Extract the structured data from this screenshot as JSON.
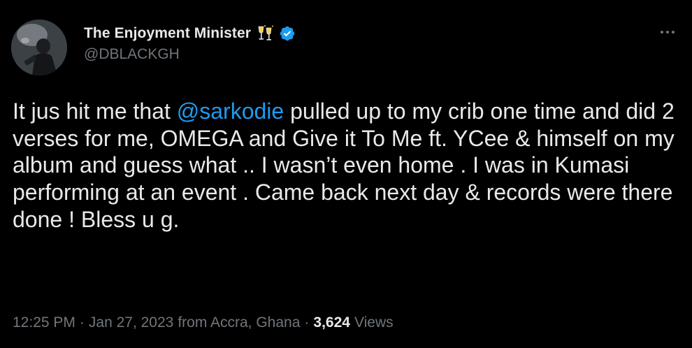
{
  "author": {
    "display_name": "The Enjoyment Minister",
    "handle": "@DBLACKGH",
    "name_emoji": "clinking-glasses-icon",
    "verified_badge": "verified-badge-icon"
  },
  "tweet": {
    "text_before_mention": "It jus hit me that ",
    "mention": "@sarkodie",
    "text_after_mention": " pulled up to my crib one time and did 2 verses for me, OMEGA and Give it To Me ft. YCee & himself on my album and guess what .. I wasn’t even home . I was in Kumasi performing at an event . Came back next day & records were there done ! Bless u g."
  },
  "meta": {
    "time": "12:25 PM",
    "separator1": "·",
    "date": "Jan 27, 2023",
    "location": "from Accra, Ghana",
    "separator2": "·",
    "views_count": "3,624",
    "views_label": "Views"
  },
  "colors": {
    "background": "#000000",
    "primary_text": "#e7e9ea",
    "secondary_text": "#71767b",
    "accent": "#1d9bf0"
  }
}
